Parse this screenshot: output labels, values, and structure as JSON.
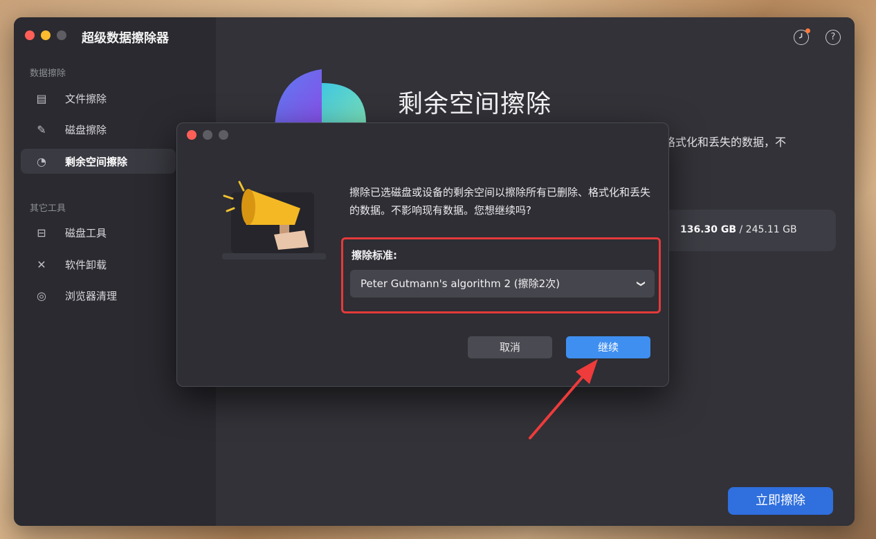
{
  "app": {
    "title": "超级数据擦除器"
  },
  "colors": {
    "accent": "#2f6fde",
    "continue": "#3f8ff0",
    "highlight": "#e53a3a"
  },
  "header": {
    "history_icon": "history-icon",
    "help_icon": "help-icon",
    "help_glyph": "?"
  },
  "sidebar": {
    "section1": "数据擦除",
    "section2": "其它工具",
    "items": [
      {
        "label": "文件擦除",
        "icon": "shredder-icon",
        "glyph": "▤"
      },
      {
        "label": "磁盘擦除",
        "icon": "disk-erase-icon",
        "glyph": "✎"
      },
      {
        "label": "剩余空间擦除",
        "icon": "pie-chart-icon",
        "glyph": "◔"
      },
      {
        "label": "磁盘工具",
        "icon": "disk-tool-icon",
        "glyph": "⊟"
      },
      {
        "label": "软件卸载",
        "icon": "uninstall-icon",
        "glyph": "✕"
      },
      {
        "label": "浏览器清理",
        "icon": "browser-icon",
        "glyph": "◎"
      }
    ]
  },
  "main": {
    "title": "剩余空间擦除",
    "desc_tail": "格式化和丢失的数据，不",
    "disk_used": "136.30 GB",
    "disk_total": " / 245.11 GB",
    "erase_button": "立即擦除"
  },
  "dialog": {
    "message": "擦除已选磁盘或设备的剩余空间以擦除所有已删除、格式化和丢失的数据。不影响现有数据。您想继续吗?",
    "standard_label": "擦除标准:",
    "standard_value": "Peter Gutmann's algorithm 2 (擦除2次)",
    "cancel": "取消",
    "continue": "继续"
  }
}
